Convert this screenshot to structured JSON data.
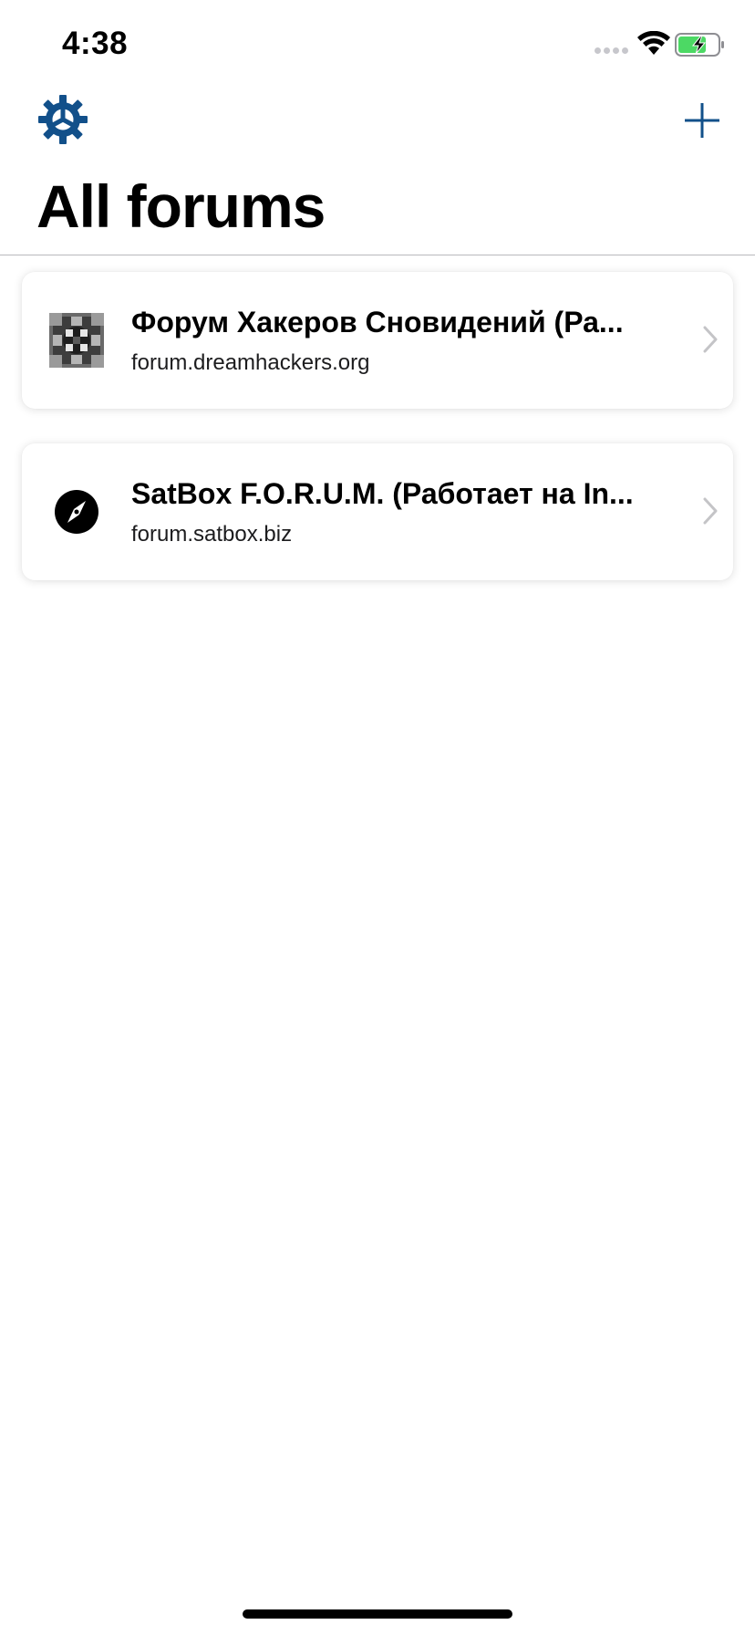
{
  "status_bar": {
    "time": "4:38"
  },
  "header": {
    "title": "All forums",
    "settings_icon": "gear-icon",
    "add_icon": "plus-icon"
  },
  "forums": [
    {
      "name": "Форум Хакеров Сновидений (Ра...",
      "url": "forum.dreamhackers.org",
      "icon": "dreamhackers-favicon"
    },
    {
      "name": "SatBox F.O.R.U.M. (Работает на In...",
      "url": "forum.satbox.biz",
      "icon": "compass-icon"
    }
  ],
  "colors": {
    "accent": "#12508a",
    "battery_fill": "#4cd964",
    "chevron": "#c4c4c7"
  }
}
